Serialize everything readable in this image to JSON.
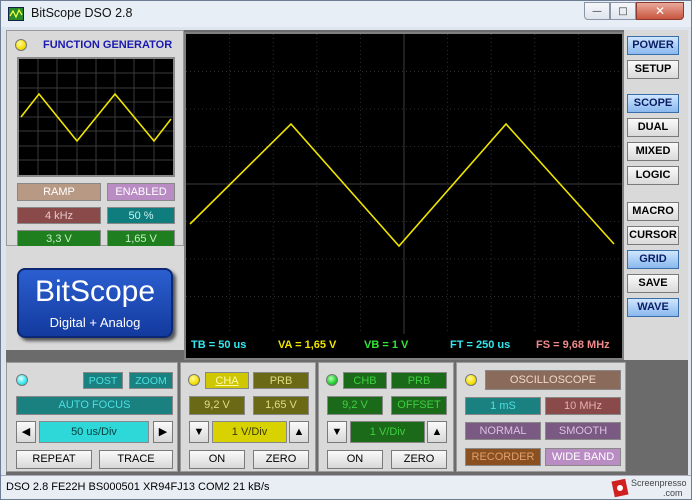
{
  "window": {
    "title": "BitScope DSO 2.8"
  },
  "function_generator": {
    "title": "FUNCTION GENERATOR",
    "waveform": "RAMP",
    "state": "ENABLED",
    "frequency": "4 kHz",
    "duty": "50 %",
    "amplitude": "3,3 V",
    "offset": "1,65 V"
  },
  "logo": {
    "main": "BitScope",
    "sub": "Digital + Analog"
  },
  "readouts": {
    "tb": "TB = 50 us",
    "va": "VA = 1,65 V",
    "vb": "VB = 1 V",
    "ft": "FT = 250 us",
    "fs": "FS = 9,68 MHz"
  },
  "right_buttons": [
    "POWER",
    "SETUP",
    "SCOPE",
    "DUAL",
    "MIXED",
    "LOGIC",
    "MACRO",
    "CURSOR",
    "GRID",
    "SAVE",
    "WAVE"
  ],
  "timebase_panel": {
    "post": "POST",
    "zoom": "ZOOM",
    "auto_focus": "AUTO FOCUS",
    "timebase": "50 us/Div",
    "repeat": "REPEAT",
    "trace": "TRACE"
  },
  "cha_panel": {
    "channel": "CHA",
    "probe": "PRB",
    "range": "9,2 V",
    "offset": "1,65 V",
    "scale": "1 V/Div",
    "on": "ON",
    "zero": "ZERO"
  },
  "chb_panel": {
    "channel": "CHB",
    "probe": "PRB",
    "range": "9,2 V",
    "offset": "OFFSET",
    "scale": "1 V/Div",
    "on": "ON",
    "zero": "ZERO"
  },
  "mode_panel": {
    "mode": "OSCILLOSCOPE",
    "duration": "1 mS",
    "rate": "10 MHz",
    "normal": "NORMAL",
    "smooth": "SMOOTH",
    "recorder": "RECORDER",
    "wide_band": "WIDE BAND"
  },
  "status": "DSO 2.8 FE22H BS000501 XR94FJ13 COM2 21 kB/s",
  "watermark": {
    "line1": "Screenpresso",
    "line2": ".com"
  }
}
